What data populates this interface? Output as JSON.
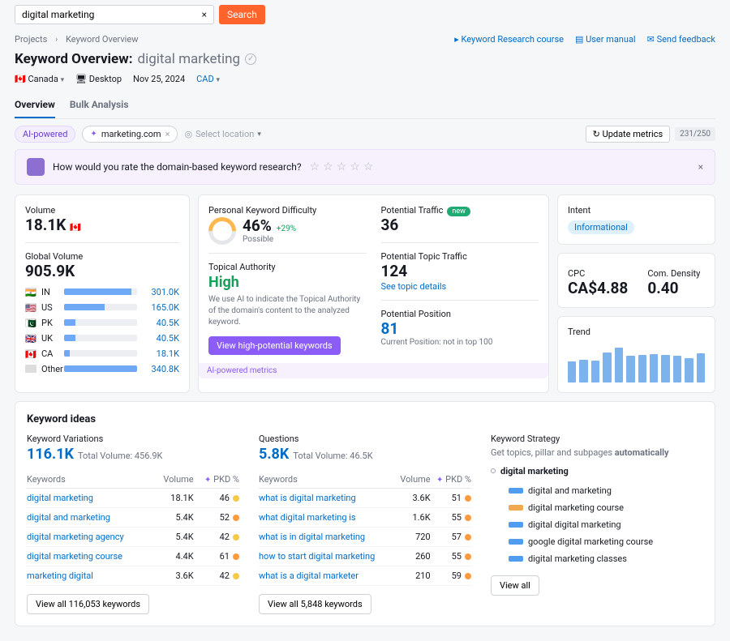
{
  "search": {
    "value": "digital marketing",
    "button": "Search"
  },
  "breadcrumbs": {
    "a": "Projects",
    "b": "Keyword Overview"
  },
  "toplinks": {
    "course": "Keyword Research course",
    "manual": "User manual",
    "feedback": "Send feedback"
  },
  "title": {
    "prefix": "Keyword Overview:",
    "keyword": "digital marketing"
  },
  "meta": {
    "country_flag": "🇨🇦",
    "country": "Canada",
    "device": "Desktop",
    "date": "Nov 25, 2024",
    "currency": "CAD"
  },
  "tabs": {
    "overview": "Overview",
    "bulk": "Bulk Analysis"
  },
  "filters": {
    "ai": "AI-powered",
    "domain": "marketing.com",
    "location": "Select location",
    "update": "Update metrics",
    "count": "231/250"
  },
  "rating_prompt": "How would you rate the domain-based keyword research?",
  "volume": {
    "label": "Volume",
    "value": "18.1K",
    "flag": "🇨🇦"
  },
  "global_volume": {
    "label": "Global Volume",
    "value": "905.9K",
    "rows": [
      {
        "flag": "🇮🇳",
        "cc": "IN",
        "pct": 92,
        "val": "301.0K"
      },
      {
        "flag": "🇺🇸",
        "cc": "US",
        "pct": 55,
        "val": "165.0K"
      },
      {
        "flag": "🇵🇰",
        "cc": "PK",
        "pct": 16,
        "val": "40.5K"
      },
      {
        "flag": "🇬🇧",
        "cc": "UK",
        "pct": 16,
        "val": "40.5K"
      },
      {
        "flag": "🇨🇦",
        "cc": "CA",
        "pct": 8,
        "val": "18.1K"
      },
      {
        "flag": "",
        "cc": "Other",
        "pct": 100,
        "val": "340.8K"
      }
    ]
  },
  "pkd": {
    "label": "Personal Keyword Difficulty",
    "value": "46%",
    "delta": "+29%",
    "sub": "Possible"
  },
  "topical": {
    "label": "Topical Authority",
    "value": "High",
    "desc": "We use AI to indicate the Topical Authority of the domain's content to the analyzed keyword.",
    "btn": "View high-potential keywords"
  },
  "potential_traffic": {
    "label": "Potential Traffic",
    "badge": "new",
    "value": "36"
  },
  "topic_traffic": {
    "label": "Potential Topic Traffic",
    "value": "124",
    "link": "See topic details"
  },
  "position": {
    "label": "Potential Position",
    "value": "81",
    "sub": "Current Position: not in top 100"
  },
  "ai_note": "AI-powered metrics",
  "intent": {
    "label": "Intent",
    "value": "Informational"
  },
  "cpc": {
    "label": "CPC",
    "value": "CA$4.88"
  },
  "density": {
    "label": "Com. Density",
    "value": "0.40"
  },
  "trend": {
    "label": "Trend",
    "bars": [
      55,
      58,
      56,
      76,
      90,
      68,
      70,
      72,
      70,
      68,
      62,
      74
    ]
  },
  "ideas_title": "Keyword ideas",
  "variations": {
    "title": "Keyword Variations",
    "big": "116.1K",
    "sub": "Total Volume: 456.9K",
    "cols": {
      "kw": "Keywords",
      "vol": "Volume",
      "pkd": "PKD %"
    },
    "rows": [
      {
        "kw": "digital marketing",
        "vol": "18.1K",
        "pkd": "46",
        "d": "dy"
      },
      {
        "kw": "digital and marketing",
        "vol": "5.4K",
        "pkd": "52",
        "d": "do"
      },
      {
        "kw": "digital marketing agency",
        "vol": "5.4K",
        "pkd": "42",
        "d": "dy"
      },
      {
        "kw": "digital marketing course",
        "vol": "4.4K",
        "pkd": "61",
        "d": "do"
      },
      {
        "kw": "marketing digital",
        "vol": "3.6K",
        "pkd": "42",
        "d": "dy"
      }
    ],
    "btn": "View all 116,053 keywords"
  },
  "questions": {
    "title": "Questions",
    "big": "5.8K",
    "sub": "Total Volume: 46.5K",
    "cols": {
      "kw": "Keywords",
      "vol": "Volume",
      "pkd": "PKD %"
    },
    "rows": [
      {
        "kw": "what is digital marketing",
        "vol": "3.6K",
        "pkd": "51",
        "d": "do"
      },
      {
        "kw": "what digital marketing is",
        "vol": "1.6K",
        "pkd": "55",
        "d": "do"
      },
      {
        "kw": "what is in digital marketing",
        "vol": "720",
        "pkd": "57",
        "d": "do"
      },
      {
        "kw": "how to start digital marketing",
        "vol": "260",
        "pkd": "55",
        "d": "do"
      },
      {
        "kw": "what is a digital marketer",
        "vol": "210",
        "pkd": "59",
        "d": "do"
      }
    ],
    "btn": "View all 5,848 keywords"
  },
  "strategy": {
    "title": "Keyword Strategy",
    "desc": "Get topics, pillar and subpages automatically",
    "root": "digital marketing",
    "items": [
      {
        "c": "mb",
        "t": "digital and marketing"
      },
      {
        "c": "mo",
        "t": "digital marketing course"
      },
      {
        "c": "mb",
        "t": "digital digital marketing"
      },
      {
        "c": "mb",
        "t": "google digital marketing course"
      },
      {
        "c": "mb",
        "t": "digital marketing classes"
      }
    ],
    "btn": "View all"
  },
  "chart_data": {
    "type": "bar",
    "title": "Trend",
    "categories": [
      "1",
      "2",
      "3",
      "4",
      "5",
      "6",
      "7",
      "8",
      "9",
      "10",
      "11",
      "12"
    ],
    "values": [
      55,
      58,
      56,
      76,
      90,
      68,
      70,
      72,
      70,
      68,
      62,
      74
    ],
    "ylim": [
      0,
      100
    ]
  }
}
